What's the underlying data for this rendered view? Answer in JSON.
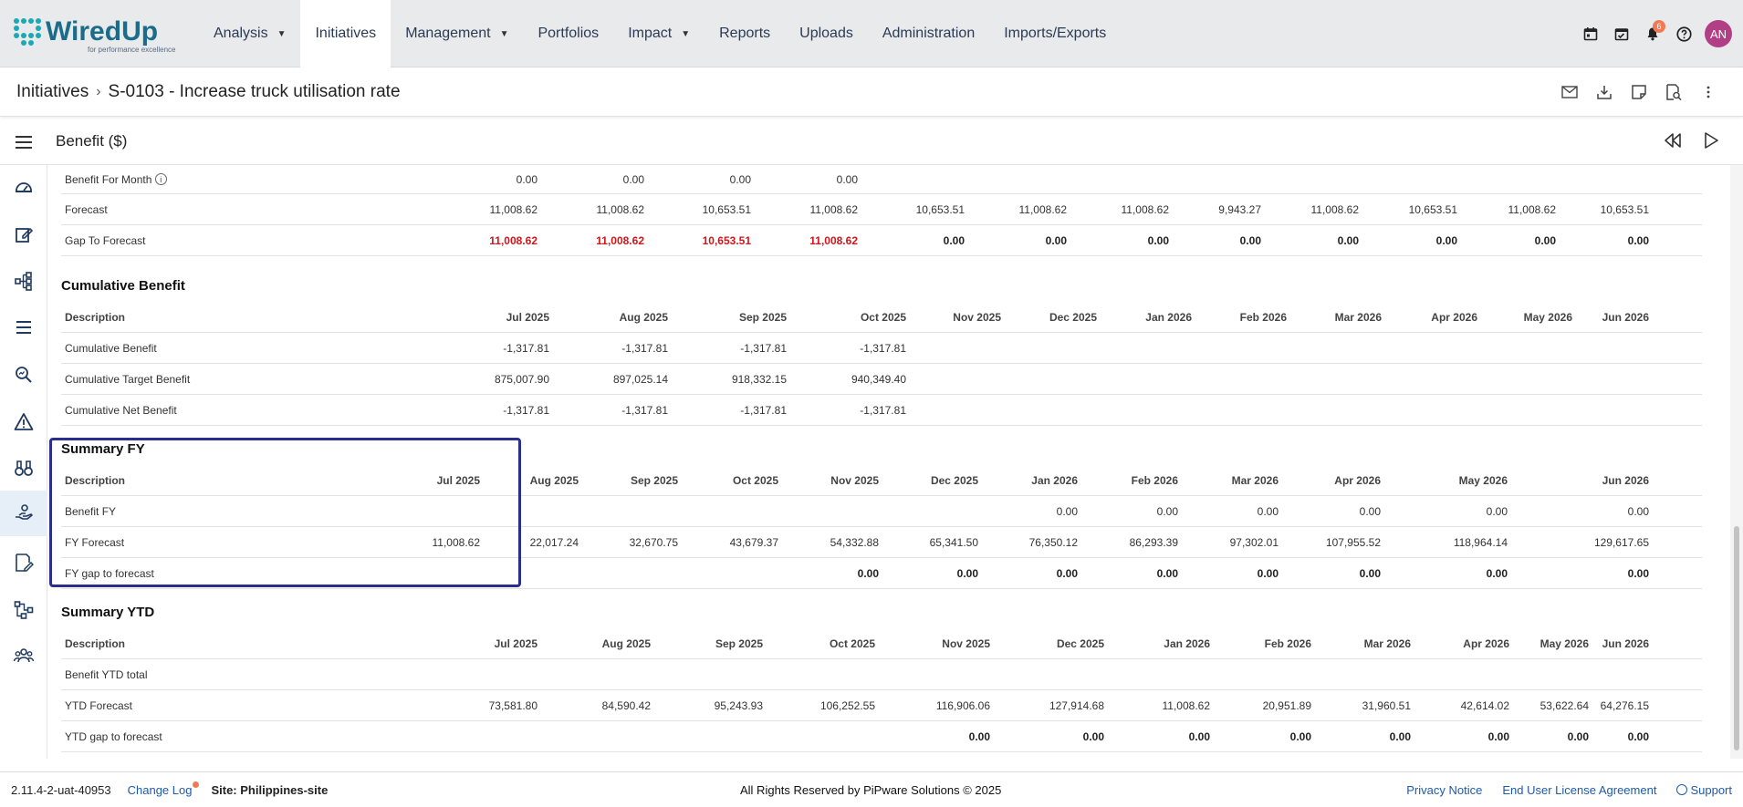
{
  "brand": {
    "name": "WiredUp",
    "tagline": "for performance excellence"
  },
  "nav": [
    {
      "label": "Analysis",
      "dropdown": true
    },
    {
      "label": "Initiatives",
      "dropdown": false,
      "active": true
    },
    {
      "label": "Management",
      "dropdown": true
    },
    {
      "label": "Portfolios",
      "dropdown": false
    },
    {
      "label": "Impact",
      "dropdown": true
    },
    {
      "label": "Reports",
      "dropdown": false
    },
    {
      "label": "Uploads",
      "dropdown": false
    },
    {
      "label": "Administration",
      "dropdown": false
    },
    {
      "label": "Imports/Exports",
      "dropdown": false
    }
  ],
  "top_icons": {
    "calendar": "calendar-icon",
    "tasks": "calendar-check-icon",
    "notifications": "bell-icon",
    "notification_count": "6",
    "help": "help-icon",
    "avatar": "AN"
  },
  "breadcrumb": {
    "root": "Initiatives",
    "current": "S-0103 - Increase truck utilisation rate"
  },
  "section": {
    "title": "Benefit ($)"
  },
  "months": [
    "Jul 2025",
    "Aug 2025",
    "Sep 2025",
    "Oct 2025",
    "Nov 2025",
    "Dec 2025",
    "Jan 2026",
    "Feb 2026",
    "Mar 2026",
    "Apr 2026",
    "May 2026",
    "Jun 2026"
  ],
  "top_rows": [
    {
      "label": "Benefit For Month",
      "info": true,
      "values": [
        "0.00",
        "0.00",
        "0.00",
        "0.00",
        "",
        "",
        "",
        "",
        "",
        "",
        "",
        ""
      ]
    },
    {
      "label": "Forecast",
      "values": [
        "11,008.62",
        "11,008.62",
        "10,653.51",
        "11,008.62",
        "10,653.51",
        "11,008.62",
        "11,008.62",
        "9,943.27",
        "11,008.62",
        "10,653.51",
        "11,008.62",
        "10,653.51"
      ]
    },
    {
      "label": "Gap To Forecast",
      "values": [
        "11,008.62",
        "11,008.62",
        "10,653.51",
        "11,008.62",
        "0.00",
        "0.00",
        "0.00",
        "0.00",
        "0.00",
        "0.00",
        "0.00",
        "0.00"
      ]
    }
  ],
  "cumulative": {
    "title": "Cumulative Benefit",
    "description_header": "Description",
    "rows": [
      {
        "label": "Cumulative Benefit",
        "values": [
          "-1,317.81",
          "-1,317.81",
          "-1,317.81",
          "-1,317.81",
          "",
          "",
          "",
          "",
          "",
          "",
          "",
          ""
        ]
      },
      {
        "label": "Cumulative Target Benefit",
        "values": [
          "875,007.90",
          "897,025.14",
          "918,332.15",
          "940,349.40",
          "",
          "",
          "",
          "",
          "",
          "",
          "",
          ""
        ]
      },
      {
        "label": "Cumulative Net Benefit",
        "values": [
          "-1,317.81",
          "-1,317.81",
          "-1,317.81",
          "-1,317.81",
          "",
          "",
          "",
          "",
          "",
          "",
          "",
          ""
        ]
      }
    ]
  },
  "summary_fy": {
    "title": "Summary FY",
    "description_header": "Description",
    "rows": [
      {
        "label": "Benefit FY",
        "values": [
          "",
          "",
          "",
          "",
          "",
          "",
          "0.00",
          "0.00",
          "0.00",
          "0.00",
          "0.00",
          "0.00"
        ]
      },
      {
        "label": "FY Forecast",
        "values": [
          "11,008.62",
          "22,017.24",
          "32,670.75",
          "43,679.37",
          "54,332.88",
          "65,341.50",
          "76,350.12",
          "86,293.39",
          "97,302.01",
          "107,955.52",
          "118,964.14",
          "129,617.65"
        ]
      },
      {
        "label": "FY gap to forecast",
        "values": [
          "",
          "",
          "",
          "",
          "0.00",
          "0.00",
          "0.00",
          "0.00",
          "0.00",
          "0.00",
          "0.00",
          "0.00"
        ]
      }
    ]
  },
  "summary_ytd": {
    "title": "Summary YTD",
    "description_header": "Description",
    "rows": [
      {
        "label": "Benefit YTD total",
        "values": [
          "",
          "",
          "",
          "",
          "",
          "",
          "",
          "",
          "",
          "",
          "",
          ""
        ]
      },
      {
        "label": "YTD Forecast",
        "values": [
          "73,581.80",
          "84,590.42",
          "95,243.93",
          "106,252.55",
          "116,906.06",
          "127,914.68",
          "11,008.62",
          "20,951.89",
          "31,960.51",
          "42,614.02",
          "53,622.64",
          "64,276.15"
        ]
      },
      {
        "label": "YTD gap to forecast",
        "values": [
          "",
          "",
          "",
          "",
          "0.00",
          "0.00",
          "0.00",
          "0.00",
          "0.00",
          "0.00",
          "0.00",
          "0.00"
        ]
      }
    ]
  },
  "footer": {
    "version": "2.11.4-2-uat-40953",
    "changelog": "Change Log",
    "site": "Site: Philippines-site",
    "copyright": "All Rights Reserved by PiPware Solutions © 2025",
    "privacy": "Privacy Notice",
    "eula": "End User License Agreement",
    "support": "Support"
  },
  "colors": {
    "accent": "#2a2f8e",
    "negative": "#d0161b",
    "avatar": "#b23e85",
    "badge": "#f07a54"
  }
}
